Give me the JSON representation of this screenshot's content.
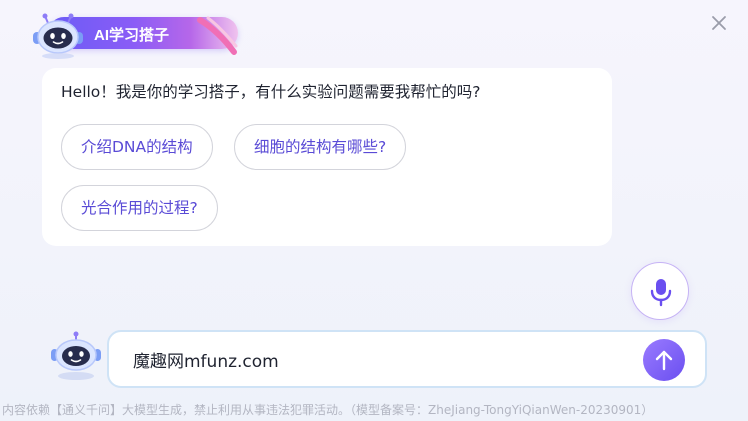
{
  "header": {
    "title": "AI学习搭子",
    "logo_icon": "robot-icon",
    "decoration_icon": "swoosh-icon"
  },
  "window": {
    "close_icon": "close-icon"
  },
  "chat": {
    "greeting": "Hello！我是你的学习搭子，有什么实验问题需要我帮忙的吗?",
    "suggestions": [
      {
        "label": "介绍DNA的结构"
      },
      {
        "label": "细胞的结构有哪些?"
      },
      {
        "label": "光合作用的过程?"
      }
    ]
  },
  "voice": {
    "icon": "microphone-icon"
  },
  "composer": {
    "avatar_icon": "robot-icon",
    "value": "魔趣网mfunz.com",
    "send_icon": "arrow-up-icon"
  },
  "footer": {
    "disclaimer": "内容依赖【通义千问】大模型生成，禁止利用从事违法犯罪活动。（模型备案号：ZheJiang-TongYiQianWen-20230901）"
  },
  "colors": {
    "accent": "#6a4ff0",
    "accent_light": "#9a7bff",
    "chip_text": "#5a4bd6",
    "background": "#f3f3fb"
  }
}
